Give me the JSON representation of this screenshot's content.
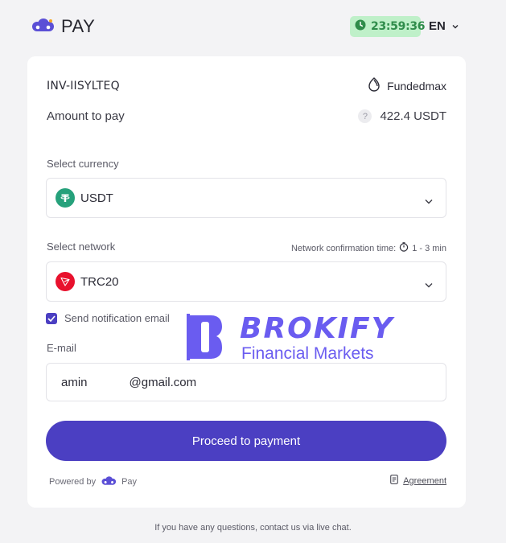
{
  "header": {
    "logo_text": "PAY",
    "timer": "23:59:36",
    "language": "EN"
  },
  "invoice": {
    "id": "INV-IISYLTEQ",
    "merchant": "Fundedmax",
    "amount_label": "Amount to pay",
    "amount_value": "422.4 USDT"
  },
  "currency": {
    "label": "Select currency",
    "selected": "USDT",
    "icon": "tether-icon",
    "icon_color": "#26a17b"
  },
  "network": {
    "label": "Select network",
    "confirmation_label": "Network confirmation time:",
    "confirmation_time": "1 - 3 min",
    "selected": "TRC20",
    "icon": "tron-icon",
    "icon_color": "#e8112d"
  },
  "notification": {
    "label": "Send notification email",
    "checked": true
  },
  "email": {
    "label": "E-mail",
    "value_start": "amin",
    "value_end": "@gmail.com"
  },
  "actions": {
    "proceed_label": "Proceed to payment"
  },
  "bottom": {
    "powered_by": "Powered by",
    "powered_brand": "Pay",
    "agreement": "Agreement"
  },
  "footer": {
    "text": "If you have any questions, contact us via live chat."
  },
  "watermark": {
    "brand": "BROKIFY",
    "subtitle": "Financial Markets",
    "color": "#6a5cf0"
  },
  "colors": {
    "accent": "#4b3fc2",
    "timer_bg": "#bff0c9",
    "timer_text": "#2f8c4a"
  }
}
